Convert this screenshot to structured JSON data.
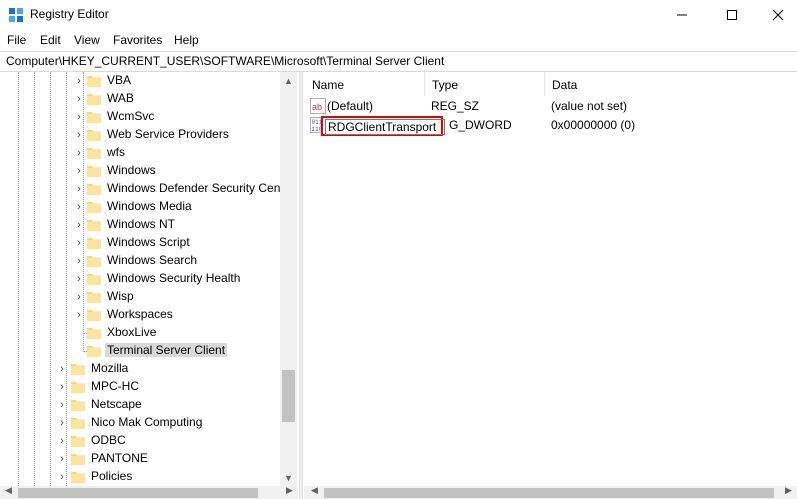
{
  "window": {
    "title": "Registry Editor"
  },
  "menu": [
    "File",
    "Edit",
    "View",
    "Favorites",
    "Help"
  ],
  "address": "Computer\\HKEY_CURRENT_USER\\SOFTWARE\\Microsoft\\Terminal Server Client",
  "tree": {
    "child_items": [
      "VBA",
      "WAB",
      "WcmSvc",
      "Web Service Providers",
      "wfs",
      "Windows",
      "Windows Defender Security Cent",
      "Windows Media",
      "Windows NT",
      "Windows Script",
      "Windows Search",
      "Windows Security Health",
      "Wisp",
      "Workspaces",
      "XboxLive",
      "Terminal Server Client"
    ],
    "selected": "Terminal Server Client",
    "sibling_items": [
      "Mozilla",
      "MPC-HC",
      "Netscape",
      "Nico Mak Computing",
      "ODBC",
      "PANTONE",
      "Policies"
    ]
  },
  "list": {
    "columns": [
      "Name",
      "Type",
      "Data"
    ],
    "rows": [
      {
        "name": "(Default)",
        "type": "REG_SZ",
        "data": "(value not set)",
        "icon": "string-value-icon"
      },
      {
        "name": "RDGClientTransport",
        "type": "G_DWORD",
        "data": "0x00000000 (0)",
        "icon": "dword-value-icon"
      }
    ],
    "rename_value": "RDGClientTransport"
  },
  "colors": {
    "highlight": "#e00000",
    "folder": "#f8d775",
    "selection": "#d9d9d9"
  }
}
